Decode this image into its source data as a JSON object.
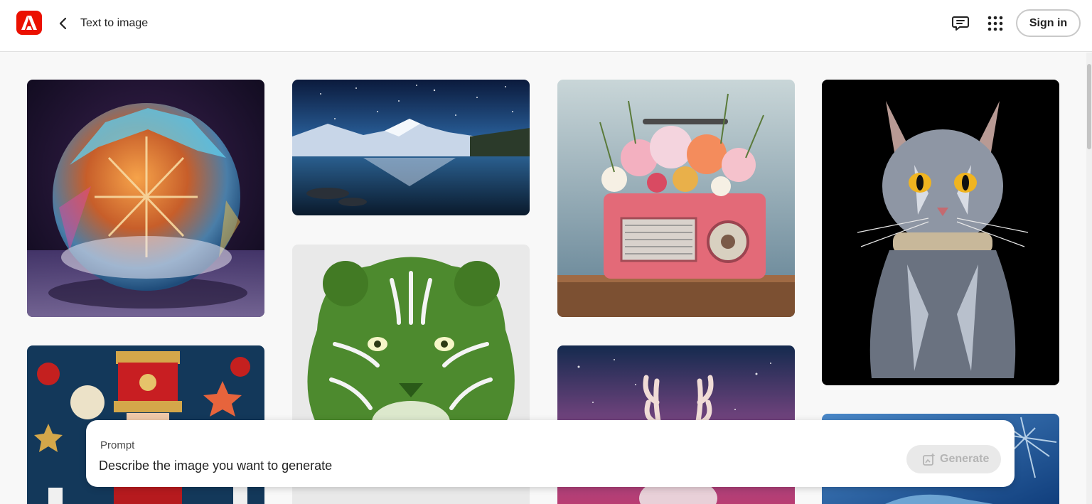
{
  "header": {
    "app_title": "Text to image",
    "sign_in_label": "Sign in"
  },
  "icons": {
    "logo": "adobe-logo-icon",
    "back": "chevron-left-icon",
    "feedback": "feedback-icon",
    "apps": "app-grid-icon",
    "generate": "sparkle-generate-icon"
  },
  "gallery": {
    "images": [
      "crystal ball with snowflake",
      "starry mountain lake reflection",
      "pink retro radio with flowers",
      "crystal cat with jeweled collar",
      "nutcracker with ornaments",
      "green grass tiger",
      "reindeer antlers night sky",
      "icy blue crystal"
    ]
  },
  "prompt": {
    "label": "Prompt",
    "placeholder": "Describe the image you want to generate",
    "generate_label": "Generate"
  },
  "colors": {
    "brand": "#eb1000",
    "background": "#f8f8f8"
  }
}
